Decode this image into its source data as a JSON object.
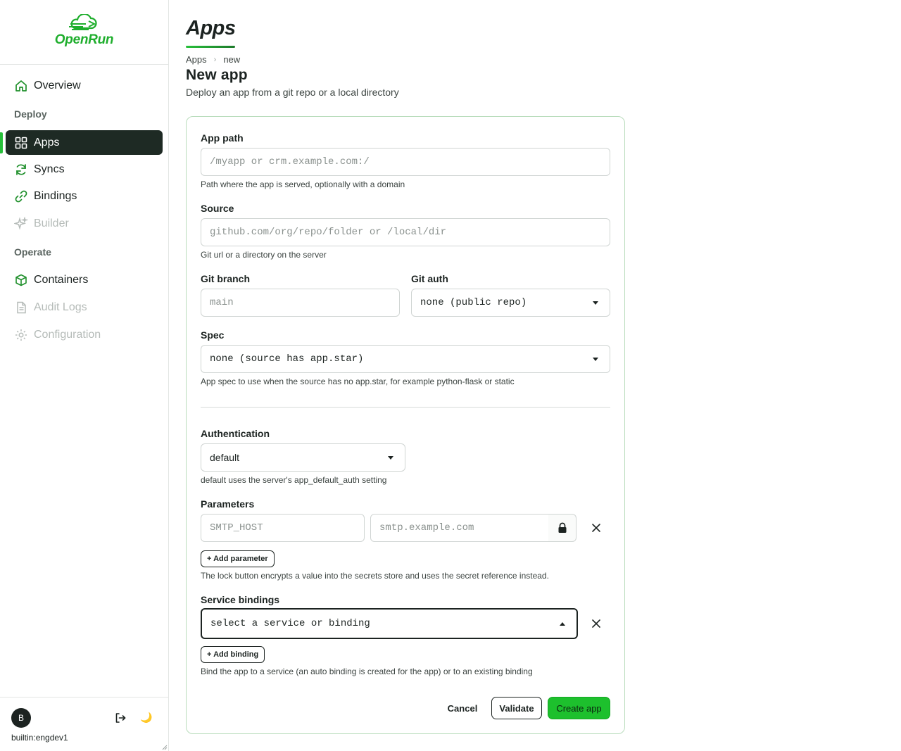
{
  "app": {
    "logo_text": "OpenRun"
  },
  "sidebar": {
    "overview": "Overview",
    "section_deploy": "Deploy",
    "apps": "Apps",
    "syncs": "Syncs",
    "bindings": "Bindings",
    "builder": "Builder",
    "section_operate": "Operate",
    "containers": "Containers",
    "audit_logs": "Audit Logs",
    "configuration": "Configuration",
    "user_initial": "B",
    "user_name": "builtin:engdev1",
    "theme_icon": "🌙"
  },
  "header": {
    "title": "Apps",
    "breadcrumb": [
      "Apps",
      "new"
    ],
    "heading": "New app",
    "subheading": "Deploy an app from a git repo or a local directory"
  },
  "form": {
    "app_path": {
      "label": "App path",
      "placeholder": "/myapp or crm.example.com:/",
      "value": "",
      "help": "Path where the app is served, optionally with a domain"
    },
    "source": {
      "label": "Source",
      "placeholder": "github.com/org/repo/folder or /local/dir",
      "value": "",
      "help": "Git url or a directory on the server"
    },
    "git_branch": {
      "label": "Git branch",
      "placeholder": "main",
      "value": ""
    },
    "git_auth": {
      "label": "Git auth",
      "selected": "none (public repo)"
    },
    "spec": {
      "label": "Spec",
      "selected": "none (source has app.star)",
      "help": "App spec to use when the source has no app.star, for example python-flask or static"
    },
    "authentication": {
      "label": "Authentication",
      "selected": "default",
      "help": "default uses the server's app_default_auth setting"
    },
    "parameters": {
      "label": "Parameters",
      "key_placeholder": "SMTP_HOST",
      "value_placeholder": "smtp.example.com",
      "add_label": "+ Add parameter",
      "help": "The lock button encrypts a value into the secrets store and uses the secret reference instead."
    },
    "service_bindings": {
      "label": "Service bindings",
      "selected": "select a service or binding",
      "add_label": "+ Add binding",
      "help": "Bind the app to a service (an auto binding is created for the app) or to an existing binding"
    },
    "actions": {
      "cancel": "Cancel",
      "validate": "Validate",
      "create": "Create app"
    }
  },
  "colors": {
    "accent": "#27c03a",
    "active_nav": "#1e2a24",
    "create_button": "#1dc02d",
    "card_border": "#b9dcbc"
  }
}
